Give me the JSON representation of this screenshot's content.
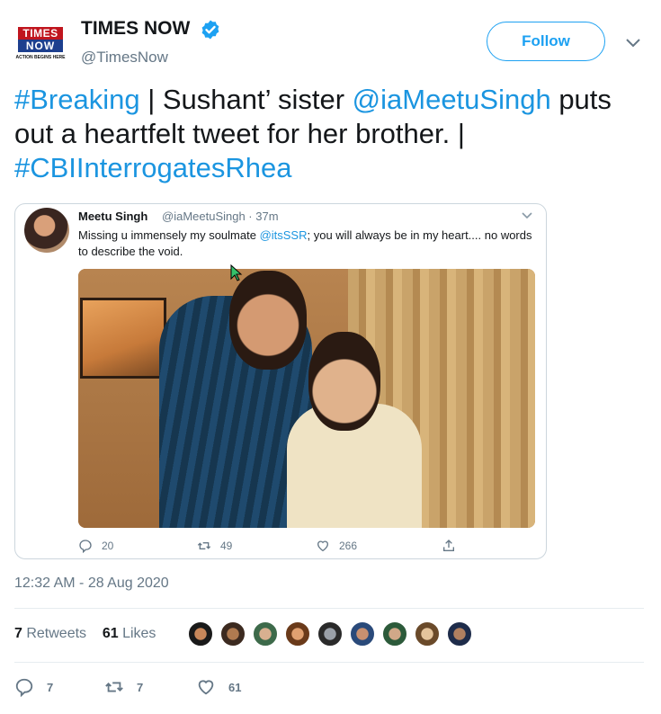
{
  "author": {
    "name": "TIMES NOW",
    "handle": "@TimesNow",
    "logo_line1": "TIMES",
    "logo_line2": "NOW",
    "logo_tagline": "ACTION BEGINS HERE",
    "verified": true
  },
  "follow_label": "Follow",
  "tweet": {
    "part1_link": "#Breaking",
    "part2": " | Sushant’ sister ",
    "part3_link": "@iaMeetuSingh",
    "part4": " puts out a heartfelt tweet for her brother. | ",
    "part5_link": "#CBIInterrogatesRhea"
  },
  "quoted": {
    "name": "Meetu Singh",
    "handle": "@iaMeetuSingh · 37m",
    "text_a": "Missing u immensely  my soulmate ",
    "text_link": "@itsSSR",
    "text_b": "; you will always be in my heart.... no words to describe the void.",
    "actions": {
      "replies": "20",
      "retweets": "49",
      "likes": "266"
    }
  },
  "timestamp": "12:32 AM - 28 Aug 2020",
  "stats": {
    "retweets_count": "7",
    "retweets_label": " Retweets",
    "likes_count": "61",
    "likes_label": " Likes"
  },
  "bottom_actions": {
    "replies": "7",
    "retweets": "7",
    "likes": "61"
  },
  "colors": {
    "link": "#1b95e0",
    "follow": "#1da1f2",
    "secondary_text": "#657786",
    "logo_red": "#c0151e",
    "logo_blue": "#1d3f8e"
  },
  "icons": {
    "verified": "verified-badge-icon",
    "caret": "chevron-down-icon",
    "reply": "reply-icon",
    "retweet": "retweet-icon",
    "like": "heart-icon",
    "share": "share-icon"
  }
}
